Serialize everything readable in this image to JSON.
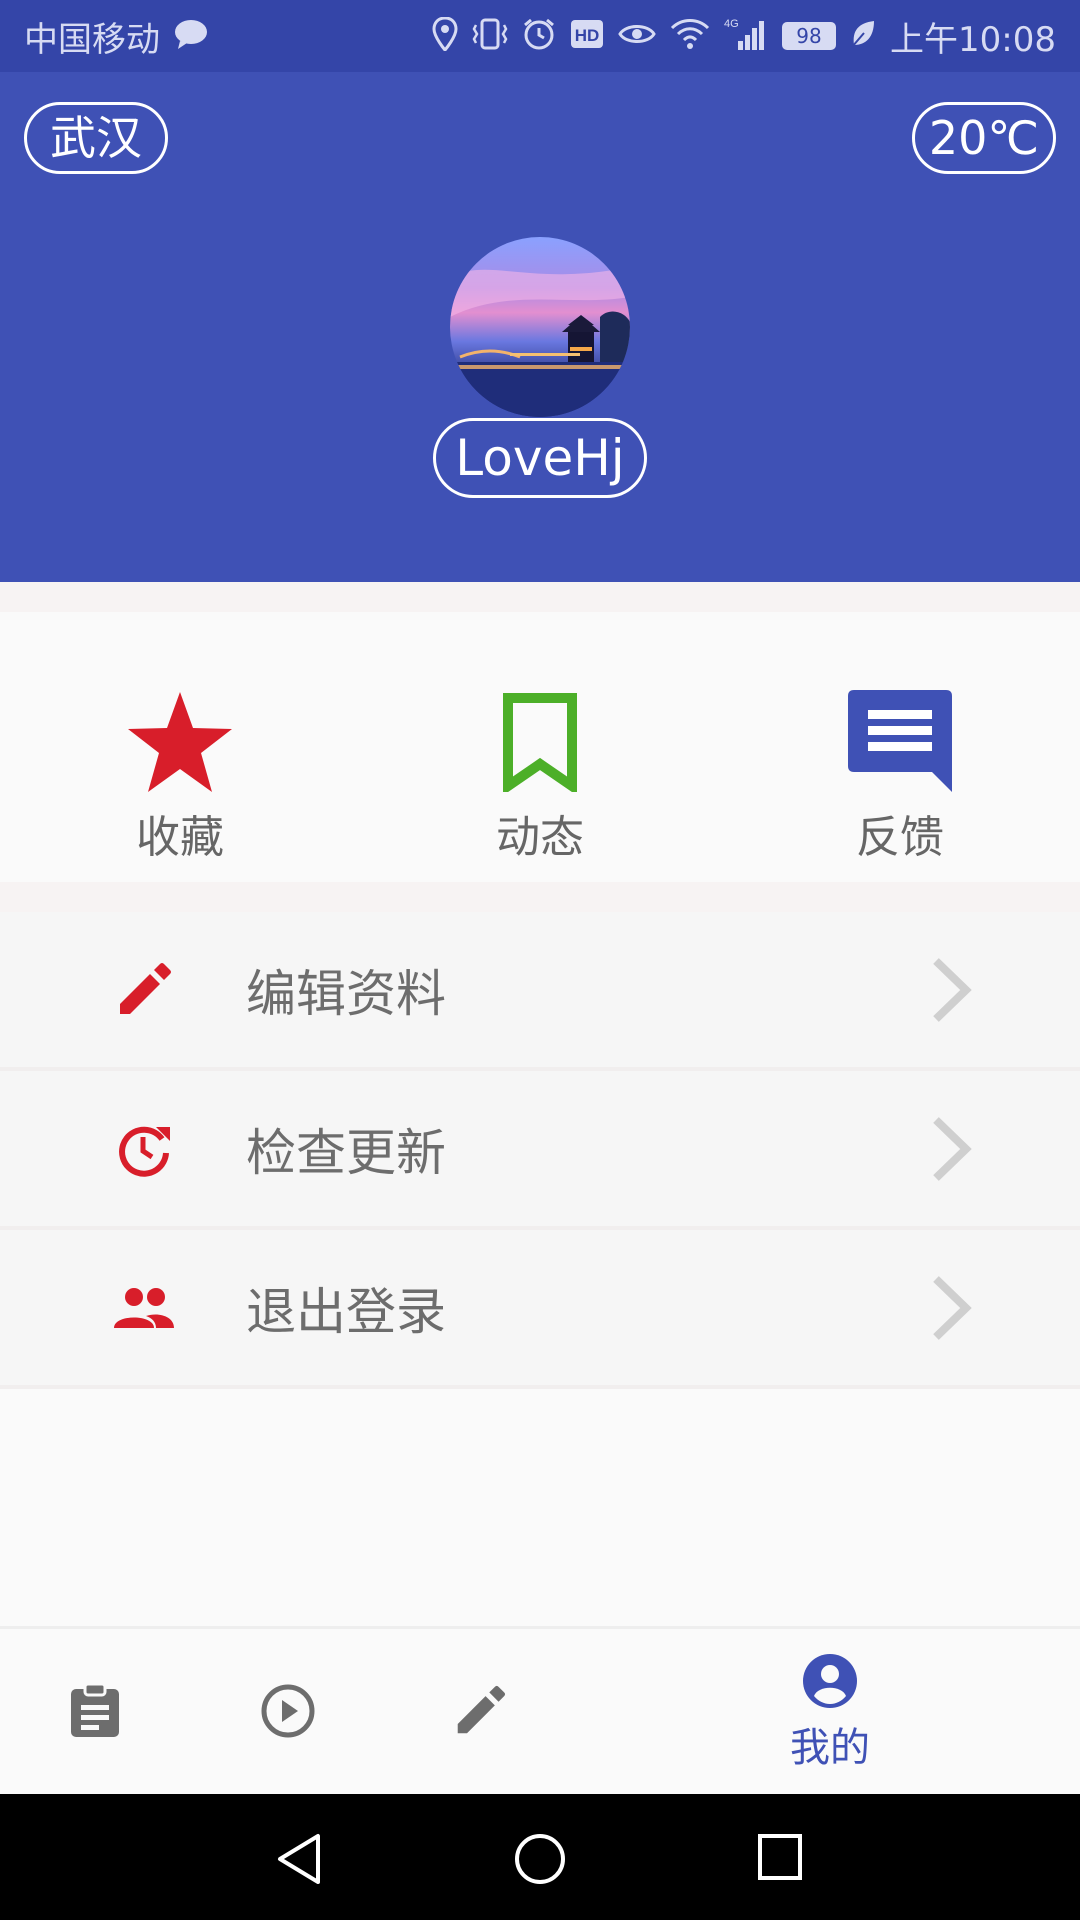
{
  "status_bar": {
    "carrier": "中国移动",
    "network": "4G",
    "battery": "98",
    "time": "上午10:08"
  },
  "header": {
    "city": "武汉",
    "temperature": "20℃",
    "username": "LoveHj"
  },
  "quick_actions": [
    {
      "label": "收藏",
      "icon": "star-icon",
      "color": "#d81e2a"
    },
    {
      "label": "动态",
      "icon": "bookmark-icon",
      "color": "#4caf28"
    },
    {
      "label": "反馈",
      "icon": "feedback-icon",
      "color": "#3f51b5"
    }
  ],
  "menu": [
    {
      "label": "编辑资料",
      "icon": "pencil-icon"
    },
    {
      "label": "检查更新",
      "icon": "update-icon"
    },
    {
      "label": "退出登录",
      "icon": "people-icon"
    }
  ],
  "bottom_nav": {
    "items": [
      {
        "icon": "clipboard-icon"
      },
      {
        "icon": "play-circle-icon"
      },
      {
        "icon": "pencil-icon"
      },
      {
        "icon": "account-circle-icon",
        "label": "我的",
        "active": true
      }
    ]
  },
  "colors": {
    "primary": "#3f51b5",
    "status_bar": "#3445a8",
    "accent_red": "#d81e2a",
    "accent_green": "#4caf28"
  }
}
